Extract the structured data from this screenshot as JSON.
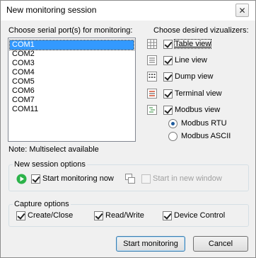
{
  "window": {
    "title": "New monitoring session",
    "close_glyph": "✕"
  },
  "ports": {
    "heading": "Choose serial port(s) for monitoring:",
    "items": [
      {
        "label": "COM1",
        "selected": true
      },
      {
        "label": "COM2",
        "selected": false
      },
      {
        "label": "COM3",
        "selected": false
      },
      {
        "label": "COM4",
        "selected": false
      },
      {
        "label": "COM5",
        "selected": false
      },
      {
        "label": "COM6",
        "selected": false
      },
      {
        "label": "COM7",
        "selected": false
      },
      {
        "label": "COM11",
        "selected": false
      }
    ],
    "note": "Note: Multiselect available"
  },
  "visualizers": {
    "heading": "Choose desired vizualizers:",
    "items": [
      {
        "label": "Table view",
        "checked": true,
        "icon": "table-view-icon"
      },
      {
        "label": "Line view",
        "checked": true,
        "icon": "line-view-icon"
      },
      {
        "label": "Dump view",
        "checked": true,
        "icon": "dump-view-icon"
      },
      {
        "label": "Terminal view",
        "checked": true,
        "icon": "terminal-view-icon"
      },
      {
        "label": "Modbus view",
        "checked": true,
        "icon": "modbus-view-icon"
      }
    ],
    "modbus_modes": [
      {
        "label": "Modbus RTU",
        "checked": true
      },
      {
        "label": "Modbus ASCII",
        "checked": false
      }
    ]
  },
  "session_options": {
    "title": "New session options",
    "start_now_label": "Start monitoring now",
    "start_now_checked": true,
    "new_window_label": "Start in new window",
    "new_window_checked": false,
    "new_window_enabled": false
  },
  "capture_options": {
    "title": "Capture options",
    "items": [
      {
        "label": "Create/Close",
        "checked": true
      },
      {
        "label": "Read/Write",
        "checked": true
      },
      {
        "label": "Device Control",
        "checked": true
      }
    ]
  },
  "buttons": {
    "start": "Start monitoring",
    "cancel": "Cancel"
  },
  "colors": {
    "selection": "#3399ff",
    "play_icon": "#2db34a"
  }
}
